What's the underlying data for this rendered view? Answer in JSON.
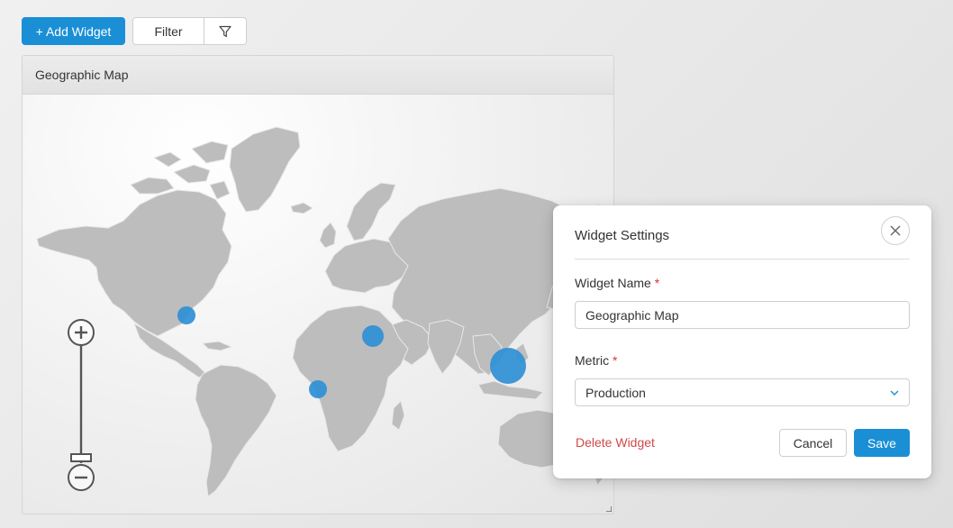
{
  "toolbar": {
    "add_widget_label": "+ Add Widget",
    "filter_label": "Filter"
  },
  "widget": {
    "title": "Geographic Map",
    "markers": [
      {
        "region": "north-america",
        "size": "small"
      },
      {
        "region": "middle-east",
        "size": "small"
      },
      {
        "region": "west-africa",
        "size": "small"
      },
      {
        "region": "southeast-asia",
        "size": "large"
      }
    ],
    "marker_color": "#2f8fd4"
  },
  "dialog": {
    "title": "Widget Settings",
    "name_label": "Widget Name",
    "name_value": "Geographic Map",
    "metric_label": "Metric",
    "metric_value": "Production",
    "required_mark": "*",
    "delete_label": "Delete Widget",
    "cancel_label": "Cancel",
    "save_label": "Save"
  },
  "colors": {
    "accent": "#1a8fd6",
    "danger": "#d04a4a",
    "land": "#bdbdbd"
  }
}
